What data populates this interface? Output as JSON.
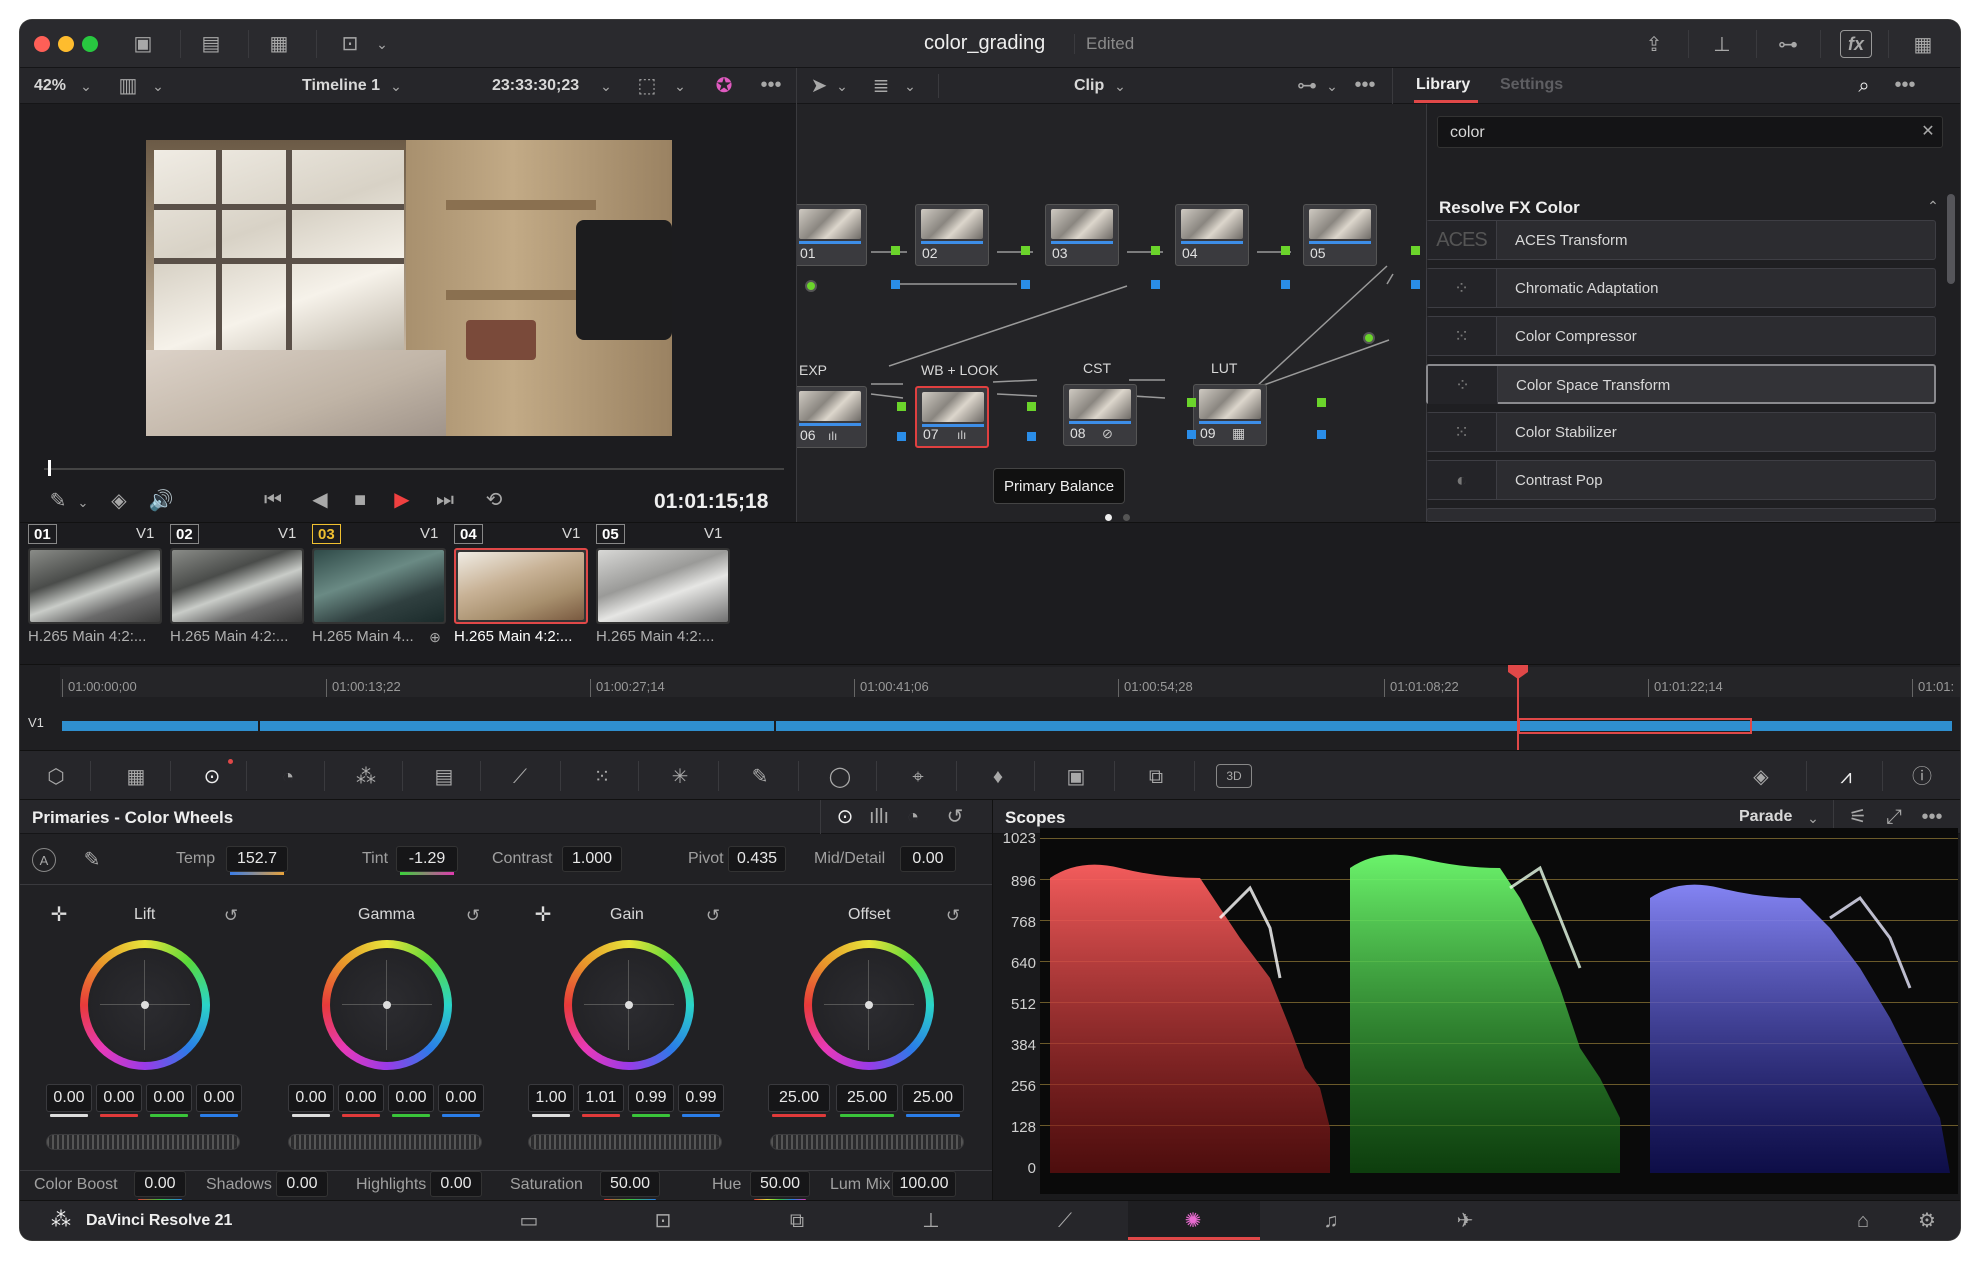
{
  "window": {
    "title": "color_grading",
    "status": "Edited"
  },
  "viewer": {
    "zoom": "42%",
    "timeline": "Timeline 1",
    "timecode": "23:33:30;23",
    "playhead_tc": "01:01:15;18"
  },
  "node_editor": {
    "mode": "Clip",
    "nodes": [
      {
        "label": "01"
      },
      {
        "label": "02"
      },
      {
        "label": "03"
      },
      {
        "label": "04"
      },
      {
        "label": "05"
      },
      {
        "label": "06",
        "name": "EXP"
      },
      {
        "label": "07",
        "name": "WB + LOOK"
      },
      {
        "label": "08",
        "name": "CST"
      },
      {
        "label": "09",
        "name": "LUT"
      }
    ],
    "tooltip": "Primary Balance"
  },
  "library": {
    "tabs": [
      "Library",
      "Settings"
    ],
    "search_value": "color",
    "section": "Resolve FX Color",
    "items": [
      {
        "name": "ACES Transform",
        "icon": "ACES"
      },
      {
        "name": "Chromatic Adaptation"
      },
      {
        "name": "Color Compressor"
      },
      {
        "name": "Color Space Transform"
      },
      {
        "name": "Color Stabilizer"
      },
      {
        "name": "Contrast Pop"
      }
    ]
  },
  "clips": [
    {
      "num": "01",
      "track": "V1",
      "codec": "H.265 Main 4:2:..."
    },
    {
      "num": "02",
      "track": "V1",
      "codec": "H.265 Main 4:2:..."
    },
    {
      "num": "03",
      "track": "V1",
      "codec": "H.265 Main 4..."
    },
    {
      "num": "04",
      "track": "V1",
      "codec": "H.265 Main 4:2:..."
    },
    {
      "num": "05",
      "track": "V1",
      "codec": "H.265 Main 4:2:..."
    }
  ],
  "ruler": [
    "01:00:00;00",
    "01:00:13;22",
    "01:00:27;14",
    "01:00:41;06",
    "01:00:54;28",
    "01:01:08;22",
    "01:01:22;14",
    "01:01:"
  ],
  "track_label": "V1",
  "primaries": {
    "title": "Primaries - Color Wheels",
    "top": [
      {
        "label": "Temp",
        "value": "152.7"
      },
      {
        "label": "Tint",
        "value": "-1.29"
      },
      {
        "label": "Contrast",
        "value": "1.000"
      },
      {
        "label": "Pivot",
        "value": "0.435"
      },
      {
        "label": "Mid/Detail",
        "value": "0.00"
      }
    ],
    "wheels": [
      {
        "name": "Lift",
        "values": [
          "0.00",
          "0.00",
          "0.00",
          "0.00"
        ]
      },
      {
        "name": "Gamma",
        "values": [
          "0.00",
          "0.00",
          "0.00",
          "0.00"
        ]
      },
      {
        "name": "Gain",
        "values": [
          "1.00",
          "1.01",
          "0.99",
          "0.99"
        ]
      },
      {
        "name": "Offset",
        "values": [
          "25.00",
          "25.00",
          "25.00"
        ]
      }
    ],
    "bottom": [
      {
        "label": "Color Boost",
        "value": "0.00"
      },
      {
        "label": "Shadows",
        "value": "0.00"
      },
      {
        "label": "Highlights",
        "value": "0.00"
      },
      {
        "label": "Saturation",
        "value": "50.00"
      },
      {
        "label": "Hue",
        "value": "50.00"
      },
      {
        "label": "Lum Mix",
        "value": "100.00"
      }
    ]
  },
  "scopes": {
    "title": "Scopes",
    "mode": "Parade",
    "axis": [
      "1023",
      "896",
      "768",
      "640",
      "512",
      "384",
      "256",
      "128",
      "0"
    ]
  },
  "footer": {
    "app": "DaVinci Resolve 21"
  }
}
